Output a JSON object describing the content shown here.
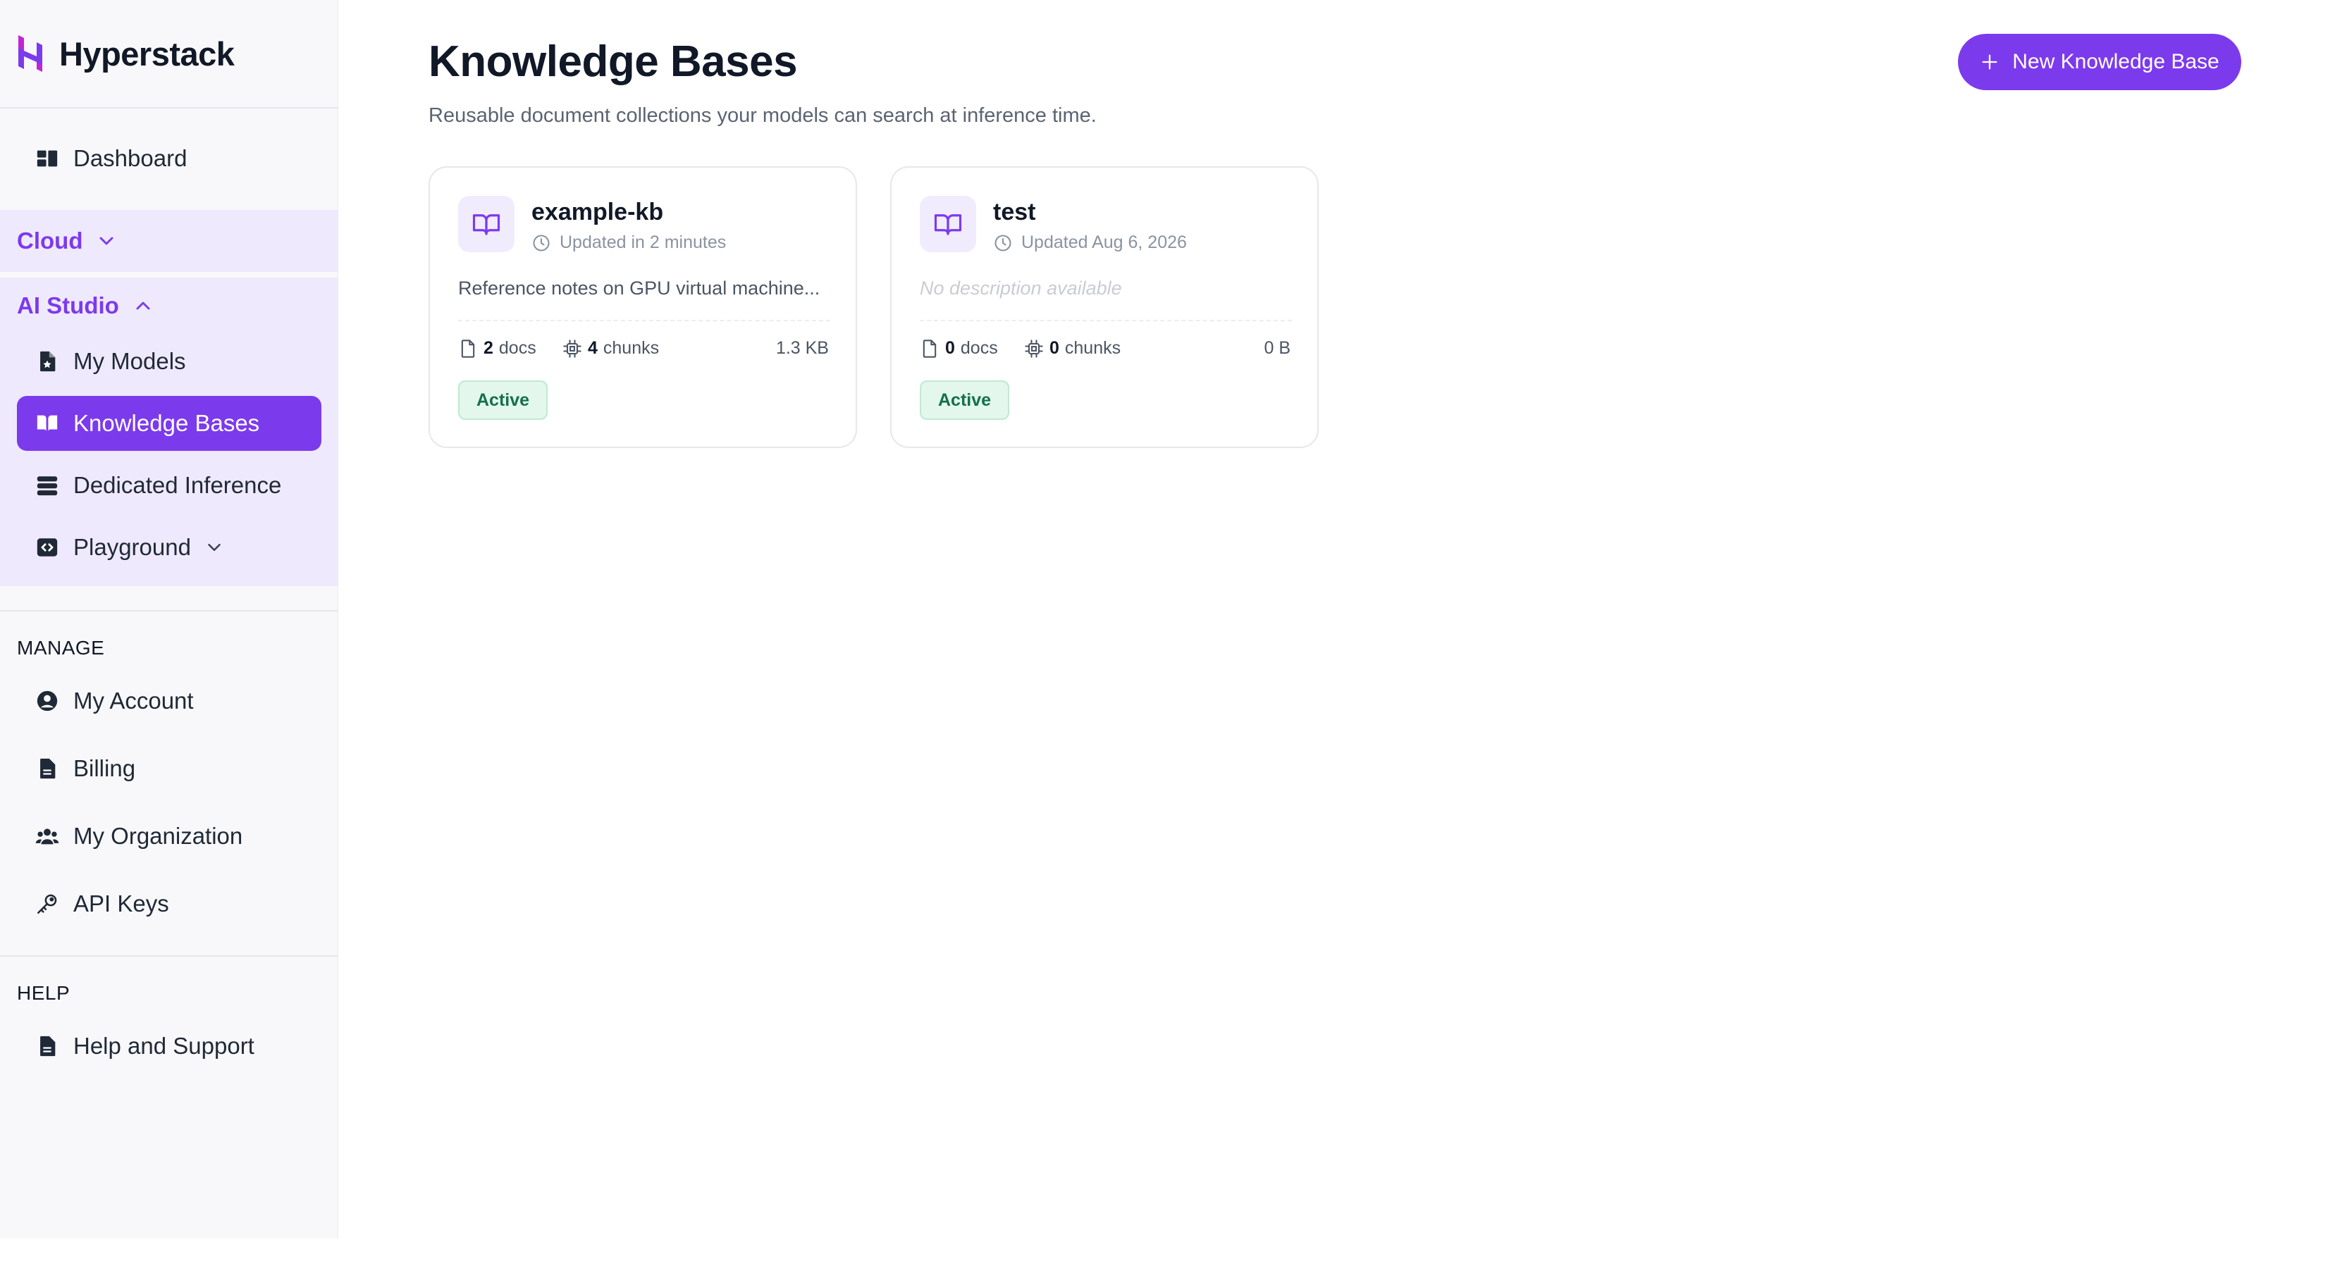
{
  "app": {
    "brand": "Hyperstack",
    "brand_color": "#7c3aed"
  },
  "sidebar": {
    "dashboard": {
      "label": "Dashboard",
      "icon": "dashboard-icon"
    },
    "cloud": {
      "label": "Cloud",
      "expanded": false
    },
    "ai_studio": {
      "label": "AI Studio",
      "expanded": true,
      "items": [
        {
          "label": "My Models",
          "icon": "model-file-icon",
          "active": false
        },
        {
          "label": "Knowledge Bases",
          "icon": "book-icon",
          "active": true
        },
        {
          "label": "Dedicated Inference",
          "icon": "server-icon",
          "active": false
        },
        {
          "label": "Playground",
          "icon": "code-icon",
          "active": false
        }
      ]
    },
    "manage": {
      "label": "MANAGE",
      "items": [
        {
          "label": "My Account",
          "icon": "user-circle-icon"
        },
        {
          "label": "Billing",
          "icon": "document-icon"
        },
        {
          "label": "My Organization",
          "icon": "users-icon"
        },
        {
          "label": "API Keys",
          "icon": "key-icon"
        }
      ]
    },
    "help": {
      "label": "HELP",
      "items": [
        {
          "label": "Help and Support",
          "icon": "document-icon"
        }
      ]
    }
  },
  "main": {
    "title": "Knowledge Bases",
    "subtitle": "Reusable document collections your models can search at inference time.",
    "new_button_label": "New Knowledge Base",
    "cards": [
      {
        "name": "example-kb",
        "updated": "Updated in 2 minutes",
        "description": "Reference notes on GPU virtual machine...",
        "docs_count": "2",
        "docs_label": "docs",
        "chunks_count": "4",
        "chunks_label": "chunks",
        "size": "1.3 KB",
        "status": "Active"
      },
      {
        "name": "test",
        "updated": "Updated Aug 6, 2026",
        "description": "No description available",
        "docs_count": "0",
        "docs_label": "docs",
        "chunks_count": "0",
        "chunks_label": "chunks",
        "size": "0 B",
        "status": "Active"
      }
    ]
  }
}
